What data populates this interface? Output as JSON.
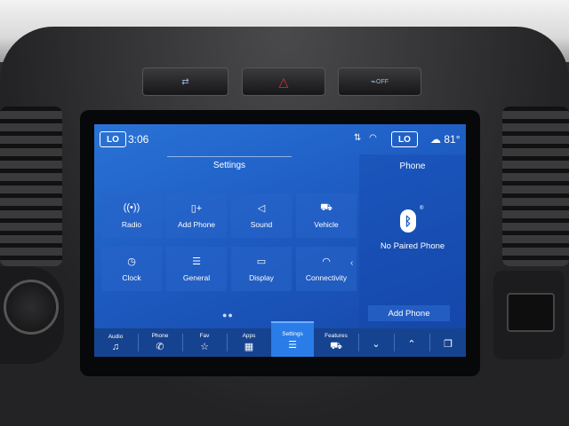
{
  "hardware_buttons": {
    "recirc_label": "",
    "hazard_symbol": "△",
    "traction_label": "OFF"
  },
  "status_bar": {
    "left_temp": "LO",
    "time": "3:06",
    "right_temp": "LO",
    "outside_temp": "81°"
  },
  "settings_panel": {
    "title": "Settings",
    "tiles": [
      {
        "label": "Radio",
        "icon": "radio-icon"
      },
      {
        "label": "Add Phone",
        "icon": "add-phone-icon"
      },
      {
        "label": "Sound",
        "icon": "speaker-icon"
      },
      {
        "label": "Vehicle",
        "icon": "vehicle-icon"
      },
      {
        "label": "Clock",
        "icon": "clock-icon"
      },
      {
        "label": "General",
        "icon": "sliders-icon"
      },
      {
        "label": "Display",
        "icon": "display-icon"
      },
      {
        "label": "Connectivity",
        "icon": "wifi-icon"
      }
    ],
    "page_dots": "●●"
  },
  "phone_panel": {
    "title": "Phone",
    "status": "No Paired Phone",
    "add_button": "Add Phone"
  },
  "nav": {
    "items": [
      {
        "label": "Audio",
        "icon": "music-note-icon"
      },
      {
        "label": "Phone",
        "icon": "phone-icon"
      },
      {
        "label": "Fav",
        "icon": "star-icon"
      },
      {
        "label": "Apps",
        "icon": "apps-grid-icon"
      },
      {
        "label": "Settings",
        "icon": "settings-sliders-icon"
      },
      {
        "label": "Features",
        "icon": "truck-icon"
      }
    ],
    "active": "Settings"
  },
  "colors": {
    "screen_blue": "#1d5bc2",
    "active_tab": "#2a7de8",
    "hazard_red": "#e03030"
  }
}
